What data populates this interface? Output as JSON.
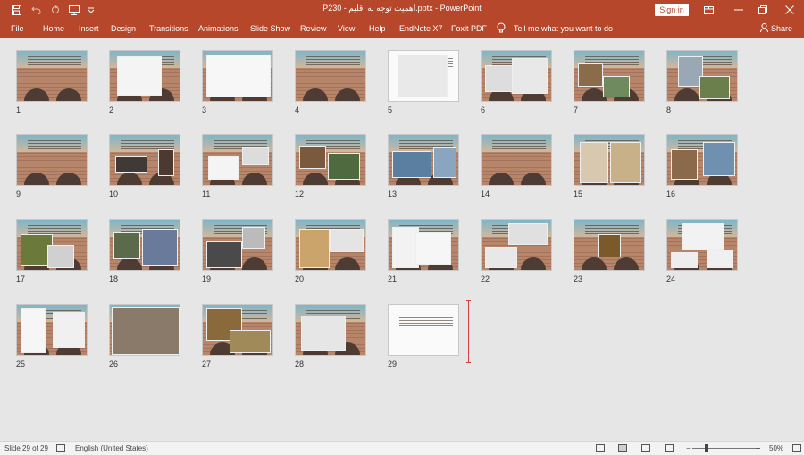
{
  "window": {
    "title": "P230 - اهمیت توجه به اقلیم.pptx  -  PowerPoint",
    "signin_label": "Sign in"
  },
  "ribbon": {
    "tabs": [
      "File",
      "Home",
      "Insert",
      "Design",
      "Transitions",
      "Animations",
      "Slide Show",
      "Review",
      "View",
      "Help",
      "EndNote X7",
      "Foxit PDF"
    ],
    "tell_me": "Tell me what you want to do",
    "share": "Share"
  },
  "slides": [
    {
      "num": "1"
    },
    {
      "num": "2"
    },
    {
      "num": "3"
    },
    {
      "num": "4"
    },
    {
      "num": "5"
    },
    {
      "num": "6"
    },
    {
      "num": "7"
    },
    {
      "num": "8"
    },
    {
      "num": "9"
    },
    {
      "num": "10"
    },
    {
      "num": "11"
    },
    {
      "num": "12"
    },
    {
      "num": "13"
    },
    {
      "num": "14"
    },
    {
      "num": "15"
    },
    {
      "num": "16"
    },
    {
      "num": "17"
    },
    {
      "num": "18"
    },
    {
      "num": "19"
    },
    {
      "num": "20"
    },
    {
      "num": "21"
    },
    {
      "num": "22"
    },
    {
      "num": "23"
    },
    {
      "num": "24"
    },
    {
      "num": "25"
    },
    {
      "num": "26"
    },
    {
      "num": "27"
    },
    {
      "num": "28"
    },
    {
      "num": "29"
    }
  ],
  "status": {
    "slide_info": "Slide 29 of 29",
    "language": "English (United States)",
    "zoom": "50%"
  },
  "colors": {
    "accent": "#b7472a",
    "workspace": "#e6e6e6"
  }
}
